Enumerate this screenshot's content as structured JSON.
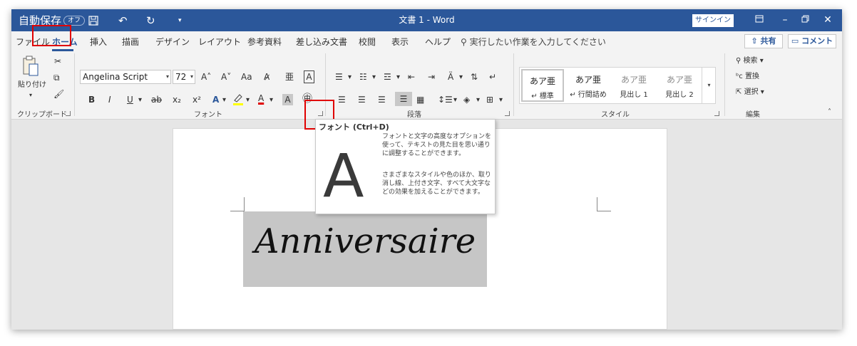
{
  "titlebar": {
    "autosave_label": "自動保存",
    "autosave_state": "オフ",
    "title": "文書 1  -  Word",
    "signin": "サインイン"
  },
  "tabs": [
    "ファイル",
    "ホーム",
    "挿入",
    "描画",
    "デザイン",
    "レイアウト",
    "参考資料",
    "差し込み文書",
    "校閲",
    "表示",
    "ヘルプ"
  ],
  "tell_me": "実行したい作業を入力してください",
  "share_label": "共有",
  "comment_label": "コメント",
  "clipboard": {
    "paste_label": "貼り付け",
    "group_label": "クリップボード"
  },
  "font": {
    "name": "Angelina Script",
    "size": "72",
    "group_label": "フォント",
    "bold": "B",
    "italic": "I",
    "underline": "U",
    "strike": "ab",
    "subscript": "x₂",
    "superscript": "x²",
    "aa": "Aa",
    "grow": "A˄",
    "shrink": "A˅",
    "ruby": "亜",
    "border_char": "A",
    "text_effect": "A",
    "font_color": "A",
    "shading": "A",
    "enclose": "㊥"
  },
  "paragraph": {
    "group_label": "段落"
  },
  "styles": {
    "group_label": "スタイル",
    "items": [
      {
        "preview": "あア亜",
        "name": "↵ 標準"
      },
      {
        "preview": "あア亜",
        "name": "↵ 行間詰め"
      },
      {
        "preview": "あア亜",
        "name": "見出し 1"
      },
      {
        "preview": "あア亜",
        "name": "見出し 2"
      }
    ]
  },
  "editing": {
    "group_label": "編集",
    "find": "検索",
    "replace": "置換",
    "select": "選択"
  },
  "document": {
    "text": "Anniversaire"
  },
  "tooltip": {
    "title": "フォント (Ctrl+D)",
    "glyph": "A",
    "desc1": "フォントと文字の高度なオプションを使って、テキストの見た目を思い通りに調整することができます。",
    "desc2": "さまざまなスタイルや色のほか、取り消し線、上付き文字、すべて大文字などの効果を加えることができます。"
  },
  "colors": {
    "brand": "#2b579a",
    "highlight": "#e00000"
  }
}
